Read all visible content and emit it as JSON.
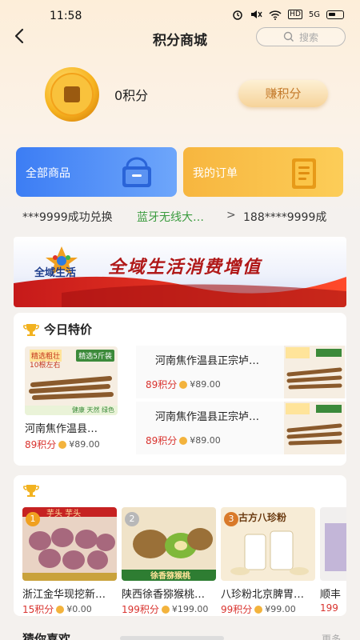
{
  "status": {
    "time": "11:58",
    "network": "HD",
    "signal": "5G"
  },
  "nav": {
    "title": "积分商城",
    "search_placeholder": "搜索"
  },
  "points": {
    "text": "0积分",
    "earn_label": "赚积分"
  },
  "cards": {
    "all_label": "全部商品",
    "orders_label": "我的订单"
  },
  "ticker": {
    "item1": "***9999成功兑换",
    "item2": "蓝牙无线大…",
    "chevron": ">",
    "item3": "188****9999成"
  },
  "banner": {
    "logo_text": "全域生活",
    "slogan": "全域生活消费增值"
  },
  "special": {
    "title": "今日特价",
    "big_item": {
      "name": "河南焦作温县…",
      "points": "89积分",
      "price": "¥89.00",
      "tag1": "精选粗壮",
      "tag2": "10根左右",
      "tag3": "精选5斤装",
      "tag4": "健康 天然 绿色"
    },
    "row_items": [
      {
        "name": "河南焦作温县正宗垆…",
        "points": "89积分",
        "price": "¥89.00"
      },
      {
        "name": "河南焦作温县正宗垆…",
        "points": "89积分",
        "price": "¥89.00"
      }
    ]
  },
  "hot": {
    "items": [
      {
        "name": "浙江金华现挖新…",
        "points": "15积分",
        "price": "¥0.00",
        "rank": "1",
        "img_text": "芋头 芋头"
      },
      {
        "name": "陕西徐香猕猴桃…",
        "points": "199积分",
        "price": "¥199.00",
        "rank": "2",
        "img_text": "徐香猕猴桃"
      },
      {
        "name": "八珍粉北京脾胃…",
        "points": "99积分",
        "price": "¥99.00",
        "rank": "3",
        "img_text": "古方八珍粉"
      },
      {
        "name": "顺丰",
        "points": "199",
        "price": ""
      }
    ]
  },
  "bottom": {
    "title": "猜你喜欢",
    "more": "更多"
  },
  "colors": {
    "blue_card": "#3c7df4",
    "orange_card": "#f7b63f",
    "points_red": "#d9332e",
    "ticker_green": "#3a9b3e"
  }
}
